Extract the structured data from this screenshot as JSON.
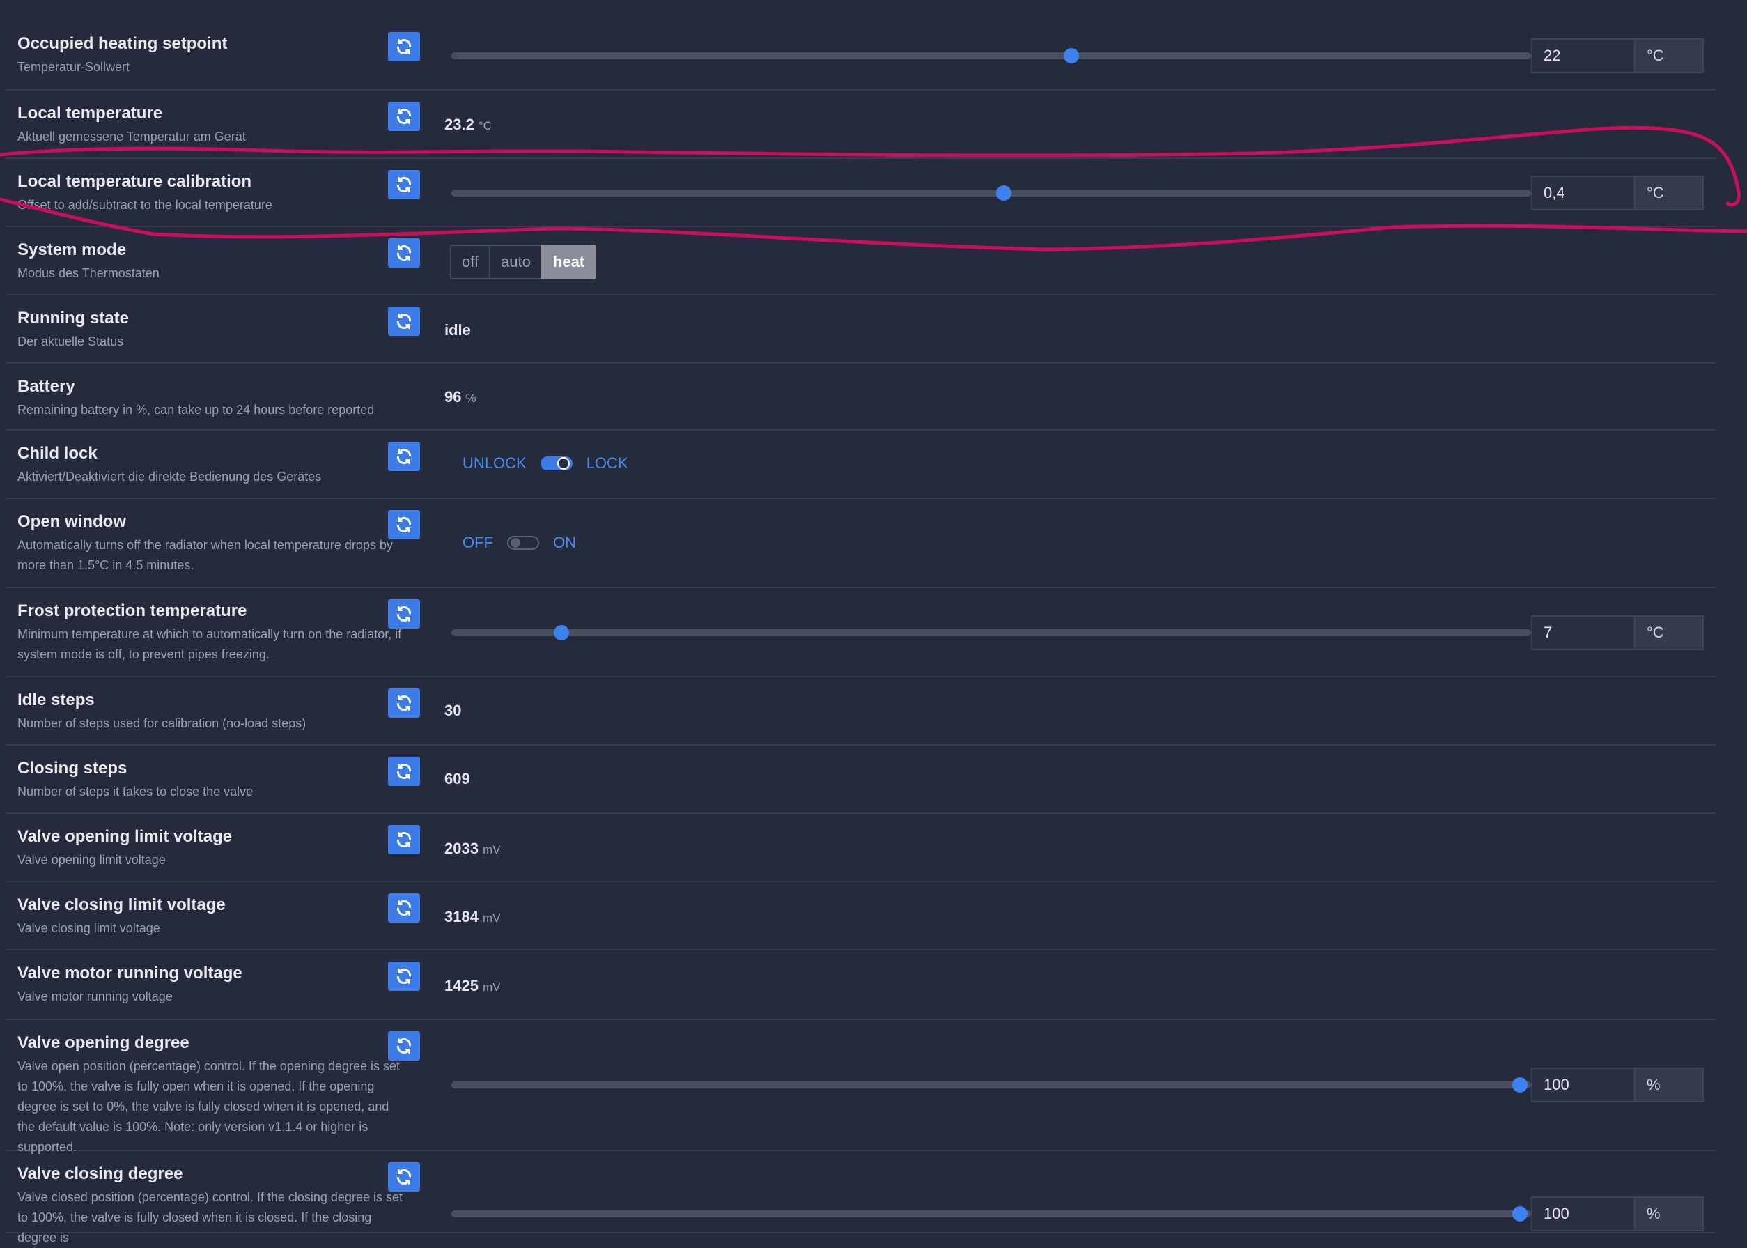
{
  "rows": [
    {
      "title": "Occupied heating setpoint",
      "desc": "Temperatur-Sollwert",
      "control": "slider",
      "value": "22",
      "unit": "°C",
      "fraction": 0.58
    },
    {
      "title": "Local temperature",
      "desc": "Aktuell gemessene Temperatur am Gerät",
      "control": "readout",
      "value": "23.2",
      "unit": "°C"
    },
    {
      "title": "Local temperature calibration",
      "desc": "Offset to add/subtract to the local temperature",
      "control": "slider",
      "value": "0,4",
      "unit": "°C",
      "fraction": 0.517
    },
    {
      "title": "System mode",
      "desc": "Modus des Thermostaten",
      "control": "segment",
      "options": [
        "off",
        "auto",
        "heat"
      ],
      "selected": "heat"
    },
    {
      "title": "Running state",
      "desc": "Der aktuelle Status",
      "control": "readout",
      "value": "idle",
      "unit": ""
    },
    {
      "title": "Battery",
      "desc": "Remaining battery in %, can take up to 24 hours before reported",
      "control": "readout",
      "value": "96",
      "unit": "%",
      "no_refresh": true
    },
    {
      "title": "Child lock",
      "desc": "Aktiviert/Deaktiviert die direkte Bedienung des Gerätes",
      "control": "toggle",
      "off_label": "UNLOCK",
      "on_label": "LOCK",
      "state": "on"
    },
    {
      "title": "Open window",
      "desc": "Automatically turns off the radiator when local temperature drops by more than 1.5°C in 4.5 minutes.",
      "control": "toggle",
      "off_label": "OFF",
      "on_label": "ON",
      "state": "off"
    },
    {
      "title": "Frost protection temperature",
      "desc": "Minimum temperature at which to automatically turn on the radiator, if system mode is off, to prevent pipes freezing.",
      "control": "slider",
      "value": "7",
      "unit": "°C",
      "fraction": 0.103
    },
    {
      "title": "Idle steps",
      "desc": "Number of steps used for calibration (no-load steps)",
      "control": "readout",
      "value": "30",
      "unit": ""
    },
    {
      "title": "Closing steps",
      "desc": "Number of steps it takes to close the valve",
      "control": "readout",
      "value": "609",
      "unit": ""
    },
    {
      "title": "Valve opening limit voltage",
      "desc": "Valve opening limit voltage",
      "control": "readout",
      "value": "2033",
      "unit": "mV"
    },
    {
      "title": "Valve closing limit voltage",
      "desc": "Valve closing limit voltage",
      "control": "readout",
      "value": "3184",
      "unit": "mV"
    },
    {
      "title": "Valve motor running voltage",
      "desc": "Valve motor running voltage",
      "control": "readout",
      "value": "1425",
      "unit": "mV"
    },
    {
      "title": "Valve opening degree",
      "desc": "Valve open position (percentage) control. If the opening degree is set to 100%, the valve is fully open when it is opened. If the opening degree is set to 0%, the valve is fully closed when it is opened, and the default value is 100%. Note: only version v1.1.4 or higher is supported.",
      "control": "slider",
      "value": "100",
      "unit": "%",
      "fraction": 1.0
    },
    {
      "title": "Valve closing degree",
      "desc": "Valve closed position (percentage) control. If the closing degree is set to 100%, the valve is fully closed when it is closed. If the closing degree is",
      "control": "slider",
      "value": "100",
      "unit": "%",
      "fraction": 1.0
    }
  ],
  "colors": {
    "background": "#252a3d",
    "accent": "#3d7be6",
    "annotation": "#c8105a"
  },
  "icons": {
    "refresh": "refresh-icon"
  }
}
